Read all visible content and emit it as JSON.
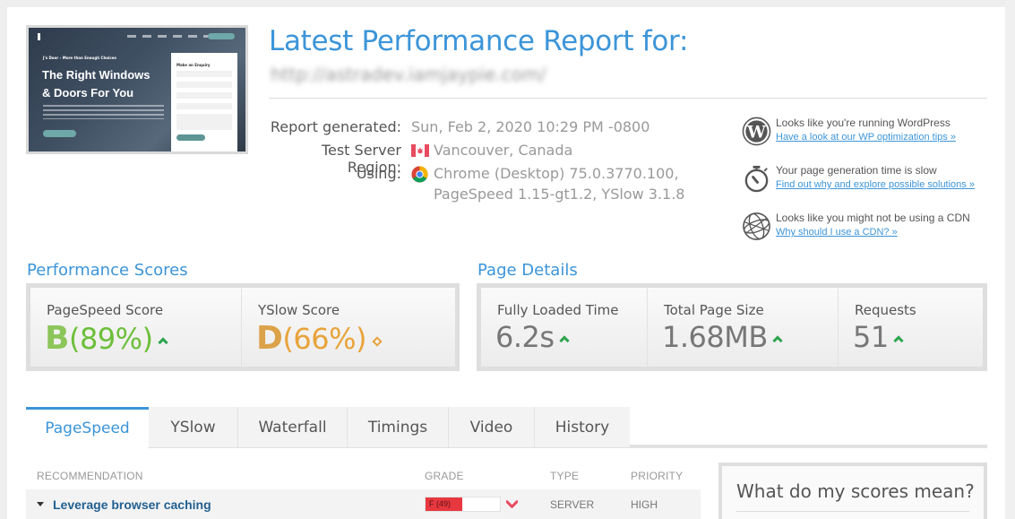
{
  "header": {
    "title": "Latest Performance Report for:",
    "url": "http://astradev.iamjaypie.com/"
  },
  "thumbnail": {
    "kicker": "J's Door - More than Enough Choices",
    "headline_line1": "The Right Windows",
    "headline_line2": "& Doors For You",
    "form_title": "Make an Enquiry"
  },
  "meta": {
    "report_generated_label": "Report generated:",
    "report_generated_value": "Sun, Feb 2, 2020 10:29 PM -0800",
    "region_label": "Test Server Region:",
    "region_value": "Vancouver, Canada",
    "using_label": "Using:",
    "using_value_line1": "Chrome (Desktop) 75.0.3770.100,",
    "using_value_line2": "PageSpeed 1.15-gt1.2, YSlow 3.1.8"
  },
  "tips": [
    {
      "icon": "wordpress-icon",
      "text": "Looks like you're running WordPress",
      "link": "Have a look at our WP optimization tips »"
    },
    {
      "icon": "stopwatch-icon",
      "text": "Your page generation time is slow",
      "link": "Find out why and explore possible solutions »"
    },
    {
      "icon": "globe-icon",
      "text": "Looks like you might not be using a CDN",
      "link": "Why should I use a CDN? »"
    }
  ],
  "performance_scores": {
    "title": "Performance Scores",
    "pagespeed": {
      "label": "PageSpeed Score",
      "grade": "B",
      "percent": "(89%)",
      "trend": "up",
      "color": "#6cbf3a"
    },
    "yslow": {
      "label": "YSlow Score",
      "grade": "D",
      "percent": "(66%)",
      "trend": "neutral",
      "color": "#e8a33a"
    }
  },
  "page_details": {
    "title": "Page Details",
    "fully_loaded": {
      "label": "Fully Loaded Time",
      "value": "6.2s",
      "trend": "up"
    },
    "page_size": {
      "label": "Total Page Size",
      "value": "1.68MB",
      "trend": "up"
    },
    "requests": {
      "label": "Requests",
      "value": "51",
      "trend": "up"
    }
  },
  "tabs": [
    {
      "label": "PageSpeed",
      "active": true
    },
    {
      "label": "YSlow",
      "active": false
    },
    {
      "label": "Waterfall",
      "active": false
    },
    {
      "label": "Timings",
      "active": false
    },
    {
      "label": "Video",
      "active": false
    },
    {
      "label": "History",
      "active": false
    }
  ],
  "table": {
    "headers": {
      "recommendation": "RECOMMENDATION",
      "grade": "GRADE",
      "type": "TYPE",
      "priority": "PRIORITY"
    },
    "rows": [
      {
        "recommendation": "Leverage browser caching",
        "grade_text": "F (49)",
        "grade_percent": 49,
        "type": "SERVER",
        "priority": "HIGH"
      }
    ]
  },
  "sidebox": {
    "title": "What do my scores mean?"
  }
}
